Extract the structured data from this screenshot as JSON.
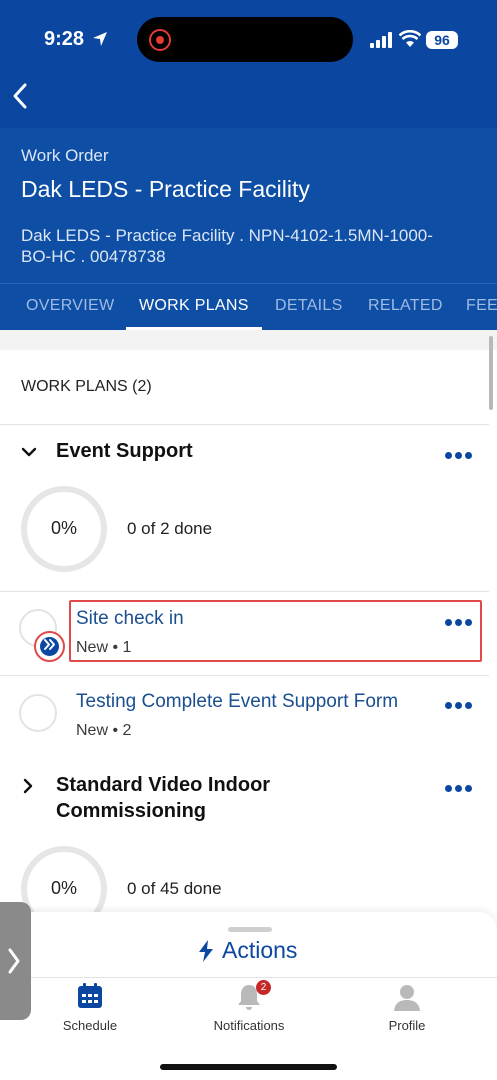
{
  "status_bar": {
    "time": "9:28",
    "battery": "96"
  },
  "work_order": {
    "label": "Work Order",
    "title": "Dak LEDS - Practice Facility",
    "subtitle_line1": "Dak LEDS - Practice Facility  .  NPN-4102-1.5MN-1000-",
    "subtitle_line2": "BO-HC  .  00478738"
  },
  "tabs": [
    {
      "label": "OVERVIEW",
      "active": false
    },
    {
      "label": "WORK PLANS",
      "active": true
    },
    {
      "label": "DETAILS",
      "active": false
    },
    {
      "label": "RELATED",
      "active": false
    },
    {
      "label": "FEE",
      "active": false
    }
  ],
  "work_plans": {
    "header": "WORK PLANS (2)",
    "groups": [
      {
        "title": "Event Support",
        "expanded": true,
        "percent": "0%",
        "progress_label": "0 of 2 done",
        "steps": [
          {
            "title": "Site check in",
            "subtitle": "New • 1"
          },
          {
            "title": "Testing Complete Event Support Form",
            "subtitle": "New • 2"
          }
        ]
      },
      {
        "title_line1": "Standard Video Indoor",
        "title_line2": "Commissioning",
        "expanded": false,
        "percent": "0%",
        "progress_label": "0 of 45 done"
      }
    ]
  },
  "actions": {
    "label": "Actions"
  },
  "bottom_nav": [
    {
      "label": "Schedule",
      "icon": "calendar-icon"
    },
    {
      "label": "Notifications",
      "icon": "bell-icon",
      "badge": "2"
    },
    {
      "label": "Profile",
      "icon": "person-icon"
    }
  ],
  "colors": {
    "brand": "#0b47a1",
    "highlight": "#e04a4a"
  }
}
